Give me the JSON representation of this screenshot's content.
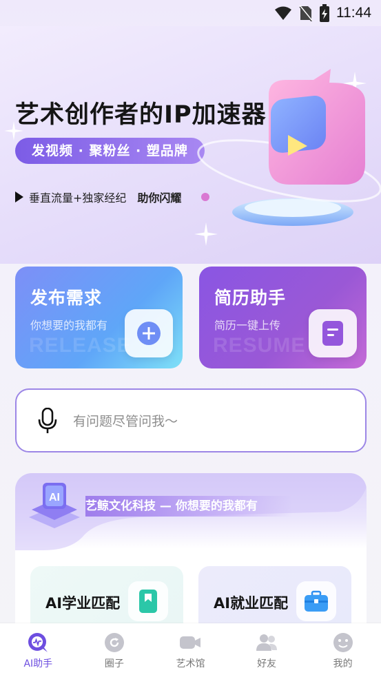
{
  "status_bar": {
    "time": "11:44"
  },
  "hero": {
    "title": "艺术创作者的IP加速器",
    "pill": "发视频 · 聚粉丝 · 塑品牌",
    "desc_main": "垂直流量+独家经纪",
    "desc_bold": "助你闪耀",
    "page_count": 4,
    "active_page": 3
  },
  "cards": {
    "release": {
      "title": "发布需求",
      "subtitle": "你想要的我都有",
      "ghost": "RELEASE"
    },
    "resume": {
      "title": "简历助手",
      "subtitle": "简历一键上传",
      "ghost": "RESUME"
    }
  },
  "ask": {
    "placeholder": "有问题尽管问我～"
  },
  "ai_section": {
    "badge": "艺鲸文化科技 — 你想要的我都有",
    "logo_text": "AI",
    "matches": [
      {
        "title": "AI学业匹配"
      },
      {
        "title": "AI就业匹配"
      }
    ]
  },
  "nav": {
    "items": [
      {
        "label": "AI助手",
        "active": true
      },
      {
        "label": "圈子"
      },
      {
        "label": "艺术馆"
      },
      {
        "label": "好友"
      },
      {
        "label": "我的"
      }
    ]
  },
  "colors": {
    "accent": "#6d4ee0",
    "inactive": "#c4c4cc"
  }
}
